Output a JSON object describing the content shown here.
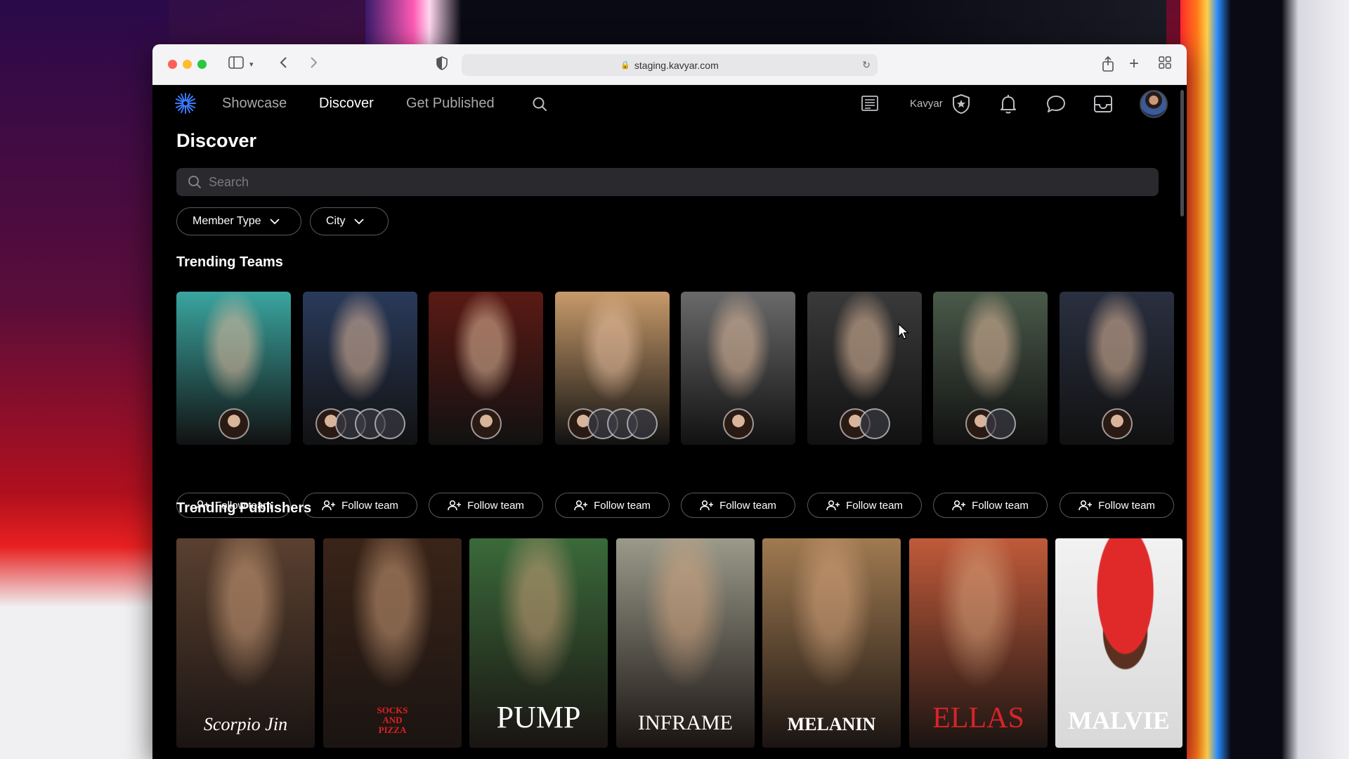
{
  "browser": {
    "url": "staging.kavyar.com"
  },
  "nav": {
    "links": [
      "Showcase",
      "Discover",
      "Get Published"
    ],
    "active": "Discover",
    "account_label": "Kavyar"
  },
  "page": {
    "title": "Discover",
    "search_placeholder": "Search",
    "filters": [
      "Member Type",
      "City"
    ]
  },
  "trending_teams": {
    "title": "Trending Teams",
    "follow_label": "Follow team",
    "cards": [
      {
        "bg": "#3aa5a0",
        "avatars": 1
      },
      {
        "bg": "#2a3a5a",
        "avatars": 4
      },
      {
        "bg": "#5a1a14",
        "avatars": 1
      },
      {
        "bg": "#c79a6a",
        "avatars": 4
      },
      {
        "bg": "#6a6a6a",
        "avatars": 1
      },
      {
        "bg": "#3a3a3a",
        "avatars": 2
      },
      {
        "bg": "#4a5a4a",
        "avatars": 2
      },
      {
        "bg": "#2a3040",
        "avatars": 1
      }
    ]
  },
  "trending_publishers": {
    "title": "Trending Publishers",
    "cards": [
      {
        "name": "Scorpio Jin",
        "bg": "#5a4030"
      },
      {
        "name": "SOCKS AND PIZZA",
        "bg": "#3a2418"
      },
      {
        "name": "PUMP",
        "bg": "#3a6a3a"
      },
      {
        "name": "INFRAME",
        "bg": "#9a9a8a"
      },
      {
        "name": "MELANIN",
        "bg": "#a07a50"
      },
      {
        "name": "ELLAS",
        "bg": "#c05a3a"
      },
      {
        "name": "MALVIE",
        "bg": "#e8e8e8"
      }
    ]
  },
  "colors": {
    "accent_logo": "#3a7aff",
    "card_text": "#ffffff",
    "ellas_red": "#d8242a",
    "socks_red": "#e02020"
  }
}
